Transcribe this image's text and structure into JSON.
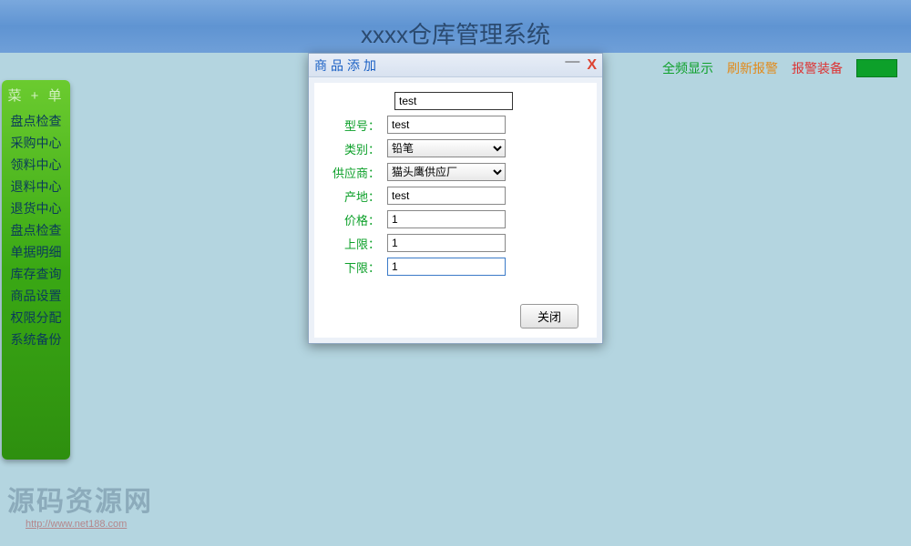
{
  "header": {
    "app_title": "xxxx仓库管理系统"
  },
  "toolbar": {
    "fullscreen": "全频显示",
    "refresh_alarm": "刷新报警",
    "alarm_equipment": "报警装备"
  },
  "sidebar": {
    "header": "菜 + 单",
    "items": [
      "盘点检查",
      "采购中心",
      "领料中心",
      "退料中心",
      "退货中心",
      "盘点检查",
      "单据明细",
      "库存查询",
      "商品设置",
      "权限分配",
      "系统备份"
    ]
  },
  "dialog": {
    "title": "商品添加",
    "fields": {
      "name_value": "test",
      "model_label": "型号：",
      "model_value": "test",
      "category_label": "类别：",
      "category_value": "铅笔",
      "supplier_label": "供应商：",
      "supplier_value": "猫头鹰供应厂",
      "origin_label": "产地：",
      "origin_value": "test",
      "price_label": "价格：",
      "price_value": "1",
      "upper_label": "上限：",
      "upper_value": "1",
      "lower_label": "下限：",
      "lower_value": "1"
    },
    "close_button": "关闭"
  },
  "watermark": {
    "title": "源码资源网",
    "url": "http://www.net188.com"
  }
}
